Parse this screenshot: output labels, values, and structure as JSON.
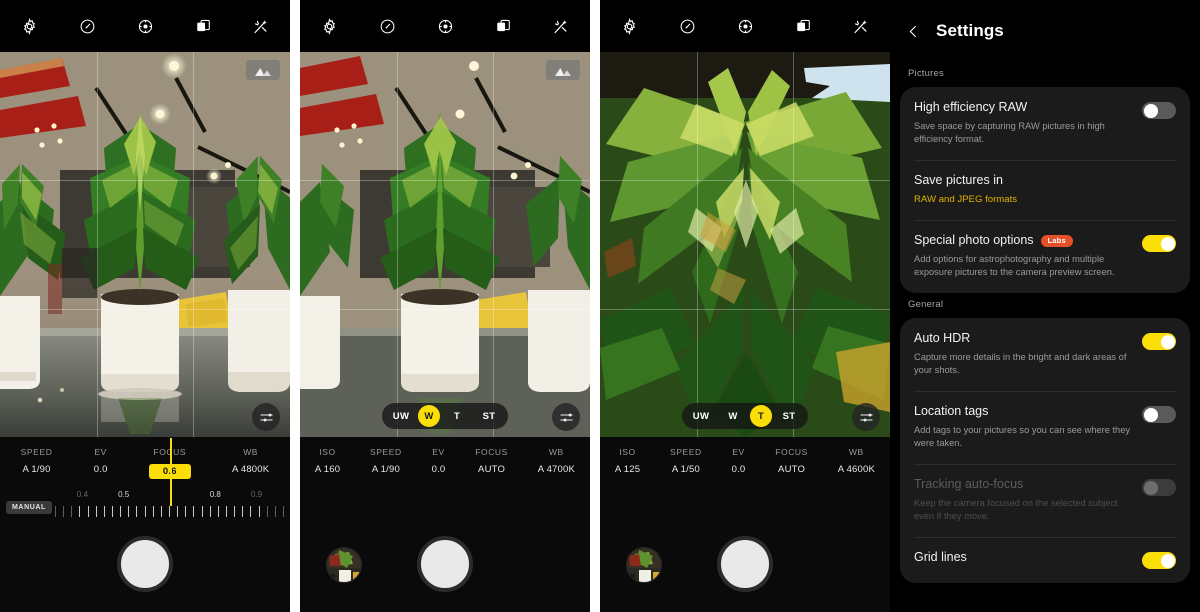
{
  "toolbar": {
    "icons": [
      {
        "name": "gear-icon",
        "label": "Settings"
      },
      {
        "name": "timer-icon",
        "label": "Timer"
      },
      {
        "name": "metering-icon",
        "label": "Metering"
      },
      {
        "name": "multi-frame-icon",
        "label": "Multi frame"
      },
      {
        "name": "effects-icon",
        "label": "Effects"
      }
    ]
  },
  "panels": [
    {
      "id": "panel-manual-focus",
      "histogram_badge": "histogram-icon",
      "zoom_levels": [],
      "selected_zoom": "",
      "pro_controls": [
        {
          "key": "SPEED",
          "value": "A 1/90",
          "highlighted": false
        },
        {
          "key": "EV",
          "value": "0.0",
          "highlighted": false
        },
        {
          "key": "FOCUS",
          "value": "0.6",
          "highlighted": true
        },
        {
          "key": "WB",
          "value": "A 4800K",
          "highlighted": false
        }
      ],
      "focus_slider": {
        "mode_label": "MANUAL",
        "ticks": [
          "0.4",
          "0.5",
          "0.8",
          "0.9"
        ],
        "tick_states": [
          "dim",
          "bright",
          "bright",
          "dim"
        ],
        "current": "0.6"
      },
      "has_thumbnail": false
    },
    {
      "id": "panel-wide",
      "histogram_badge": "histogram-icon",
      "zoom_levels": [
        "UW",
        "W",
        "T",
        "ST"
      ],
      "selected_zoom": "W",
      "pro_controls": [
        {
          "key": "ISO",
          "value": "A 160",
          "highlighted": false
        },
        {
          "key": "SPEED",
          "value": "A 1/90",
          "highlighted": false
        },
        {
          "key": "EV",
          "value": "0.0",
          "highlighted": false
        },
        {
          "key": "FOCUS",
          "value": "AUTO",
          "highlighted": false
        },
        {
          "key": "WB",
          "value": "A 4700K",
          "highlighted": false
        }
      ],
      "focus_slider": null,
      "has_thumbnail": true
    },
    {
      "id": "panel-tele",
      "histogram_badge": "",
      "zoom_levels": [
        "UW",
        "W",
        "T",
        "ST"
      ],
      "selected_zoom": "T",
      "pro_controls": [
        {
          "key": "ISO",
          "value": "A 125",
          "highlighted": false
        },
        {
          "key": "SPEED",
          "value": "A 1/50",
          "highlighted": false
        },
        {
          "key": "EV",
          "value": "0.0",
          "highlighted": false
        },
        {
          "key": "FOCUS",
          "value": "AUTO",
          "highlighted": false
        },
        {
          "key": "WB",
          "value": "A 4600K",
          "highlighted": false
        }
      ],
      "focus_slider": null,
      "has_thumbnail": true
    }
  ],
  "settings": {
    "title": "Settings",
    "back_icon": "chevron-left-icon",
    "sections": [
      {
        "label": "Pictures",
        "items": [
          {
            "title": "High efficiency RAW",
            "subtitle": "Save space by capturing RAW pictures in high efficiency format.",
            "subtitle_accent": false,
            "badge": "",
            "control": "toggle",
            "toggle_on": false,
            "disabled": false
          },
          {
            "title": "Save pictures in",
            "subtitle": "RAW and JPEG formats",
            "subtitle_accent": true,
            "badge": "",
            "control": "none",
            "toggle_on": false,
            "disabled": false
          },
          {
            "title": "Special photo options",
            "subtitle": "Add options for astrophotography and multiple exposure pictures to the camera preview screen.",
            "subtitle_accent": false,
            "badge": "Labs",
            "control": "toggle",
            "toggle_on": true,
            "disabled": false
          }
        ]
      },
      {
        "label": "General",
        "items": [
          {
            "title": "Auto HDR",
            "subtitle": "Capture more details in the bright and dark areas of your shots.",
            "subtitle_accent": false,
            "badge": "",
            "control": "toggle",
            "toggle_on": true,
            "disabled": false
          },
          {
            "title": "Location tags",
            "subtitle": "Add tags to your pictures so you can see where they were taken.",
            "subtitle_accent": false,
            "badge": "",
            "control": "toggle",
            "toggle_on": false,
            "disabled": false
          },
          {
            "title": "Tracking auto-focus",
            "subtitle": "Keep the camera focused on the selected subject even if they move.",
            "subtitle_accent": false,
            "badge": "",
            "control": "toggle",
            "toggle_on": false,
            "disabled": true
          },
          {
            "title": "Grid lines",
            "subtitle": "",
            "subtitle_accent": false,
            "badge": "",
            "control": "toggle",
            "toggle_on": true,
            "disabled": false
          }
        ]
      }
    ]
  },
  "colors": {
    "accent_yellow": "#FBDD07",
    "accent_yellow_text": "#E0B400",
    "labs_badge": "#E8502A",
    "panel_bg": "#0a0a0a",
    "card_bg": "#1b1b1b"
  }
}
